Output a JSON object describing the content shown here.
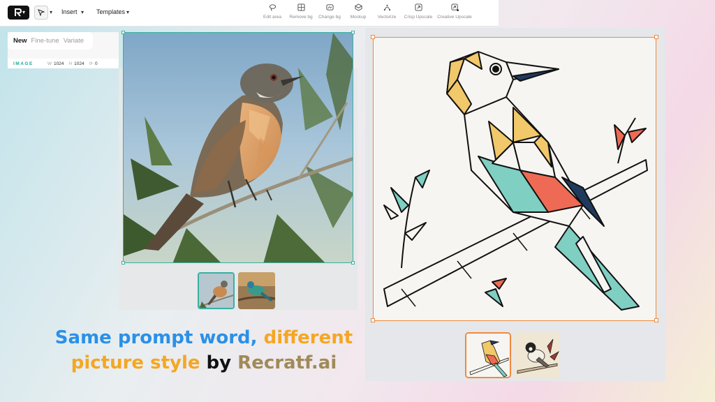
{
  "toolbar": {
    "insert_label": "Insert",
    "templates_label": "Templates",
    "tools": [
      {
        "label": "Edit area",
        "icon": "lasso-icon"
      },
      {
        "label": "Remove bg",
        "icon": "remove-bg-icon"
      },
      {
        "label": "Change bg",
        "icon": "change-bg-icon"
      },
      {
        "label": "Mockup",
        "icon": "mockup-icon"
      },
      {
        "label": "Vectorize",
        "icon": "vectorize-icon"
      },
      {
        "label": "Crisp Upscale",
        "icon": "crisp-upscale-icon"
      },
      {
        "label": "Creative Upscale",
        "icon": "creative-upscale-icon"
      }
    ]
  },
  "panel": {
    "tabs": [
      "New",
      "Fine-tune",
      "Variate"
    ],
    "active_tab": "New",
    "image_label": "IMAGE",
    "width_key": "W",
    "width_value": "1024",
    "height_key": "H",
    "height_value": "1024",
    "rotation_value": "0"
  },
  "caption": {
    "part1": "Same prompt word, ",
    "part2": "different",
    "part3": "picture style",
    "part4": " by ",
    "part5": "Recratf.ai"
  },
  "colors": {
    "accent_teal": "#39b0a2",
    "accent_orange": "#f08a3c",
    "caption_blue": "#2a90e8",
    "caption_orange": "#f5a623",
    "caption_gold": "#a08a58"
  }
}
